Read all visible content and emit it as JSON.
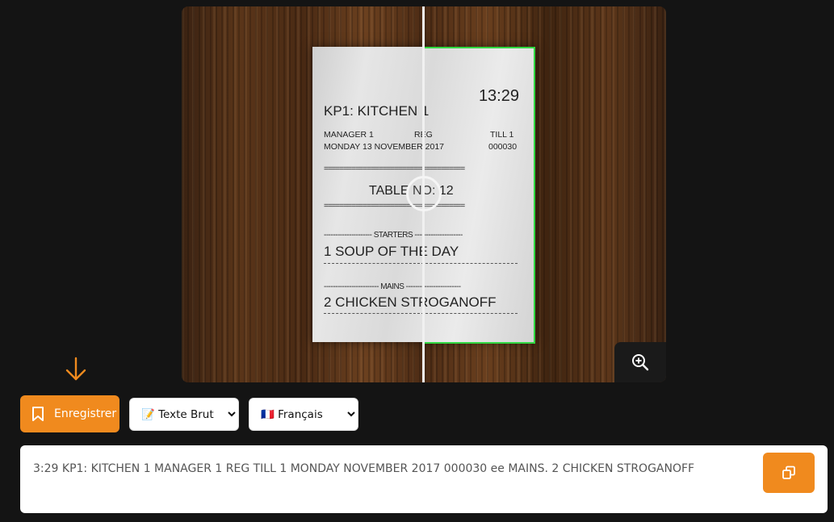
{
  "viewer": {
    "receipt": {
      "time": "13:29",
      "header": "KP1: KITCHEN 1",
      "manager": "MANAGER 1",
      "reg": "REG",
      "till": "TILL 1",
      "date": "MONDAY  13 NOVEMBER 2017",
      "number": "000030",
      "separator": "====================================",
      "table": "TABLE NO: 12",
      "starters": "--------------------- STARTERS ---------------------",
      "item1": "1 SOUP OF THE DAY",
      "mains": "------------------------ MAINS ------------------------",
      "item2": "2 CHICKEN STROGANOFF"
    },
    "zoom_icon": "zoom-in-icon"
  },
  "toolbar": {
    "save_label": "Enregistrer",
    "format_selected": "📝 Texte Brut",
    "language_selected": "🇫🇷 Français"
  },
  "result": {
    "text": "3:29 KP1: KITCHEN 1 MANAGER 1 REG TILL 1 MONDAY NOVEMBER 2017 000030 ee MAINS. 2 CHICKEN STROGANOFF"
  },
  "colors": {
    "accent": "#f08a1e",
    "detection_box": "#31d842",
    "background": "#141414"
  }
}
